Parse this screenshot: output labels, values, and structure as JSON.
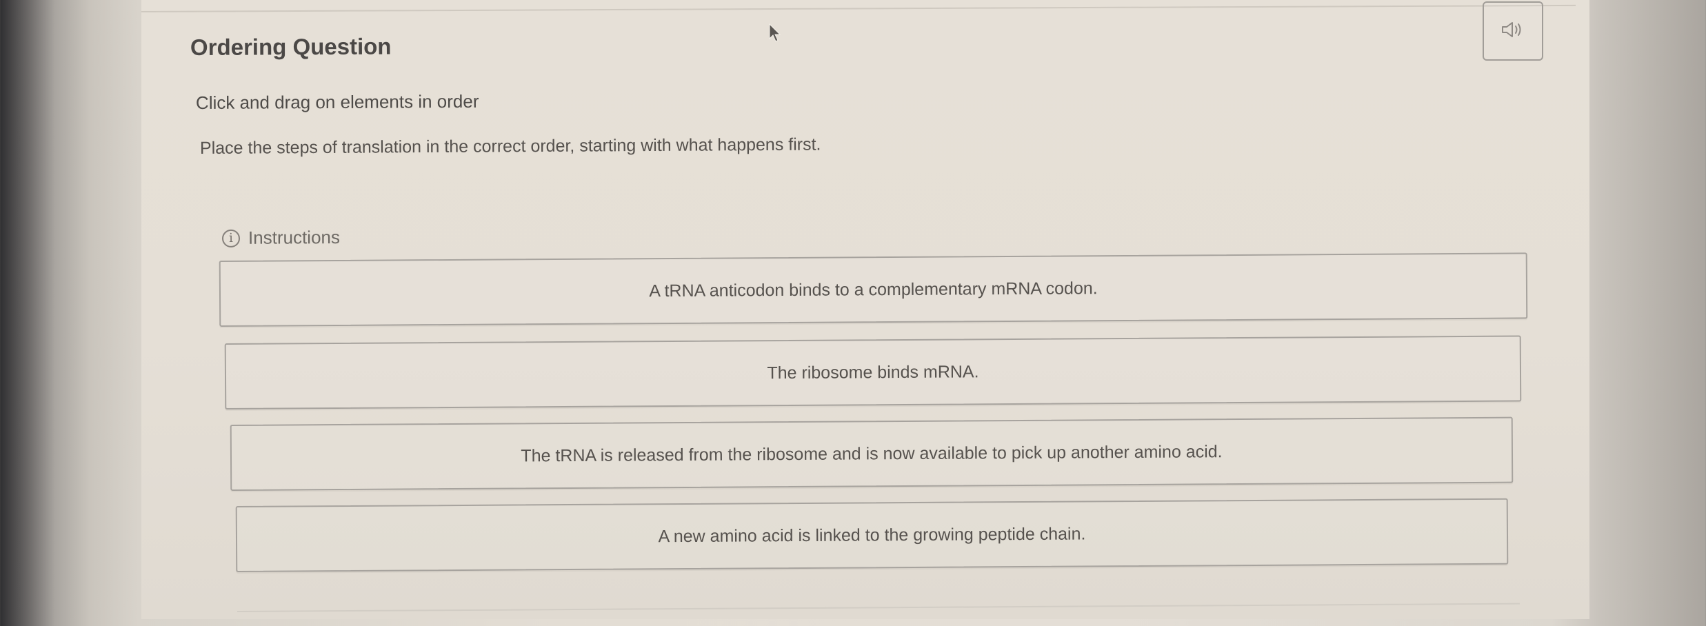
{
  "question": {
    "title": "Ordering Question",
    "subtitle": "Click and drag on elements in order",
    "prompt": "Place the steps of translation in the correct order, starting with what happens first."
  },
  "instructions": {
    "label": "Instructions",
    "icon": "info-icon"
  },
  "audio": {
    "icon": "speaker-icon"
  },
  "order_items": [
    {
      "label": "A tRNA anticodon binds to a complementary mRNA codon."
    },
    {
      "label": "The ribosome binds mRNA."
    },
    {
      "label": "The tRNA is released from the ribosome and is now available to pick up another amino acid."
    },
    {
      "label": "A new amino acid is linked to the growing peptide chain."
    }
  ],
  "colors": {
    "text": "#4b4846",
    "border": "#a7a39e",
    "background": "#e6e0d7"
  }
}
